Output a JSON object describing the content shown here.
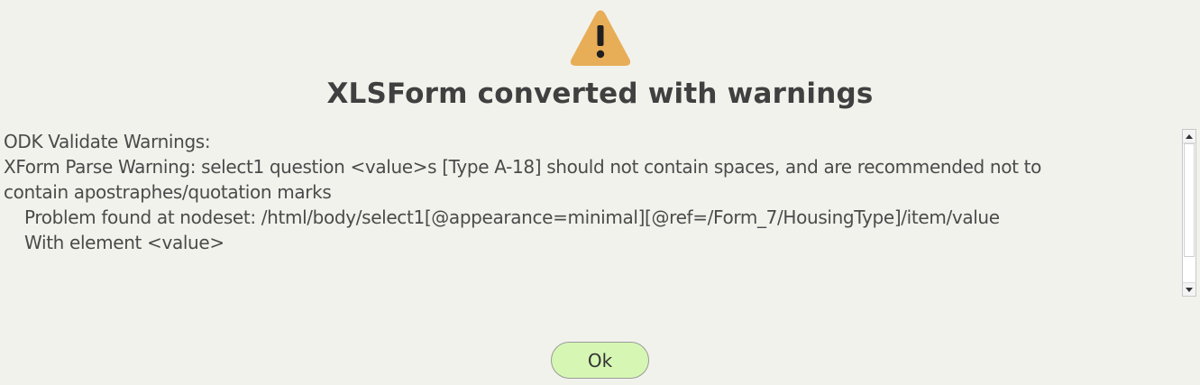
{
  "dialog": {
    "icon": "warning-triangle-icon",
    "icon_color": "#e8ad57",
    "title": "XLSForm converted with warnings",
    "messages": [
      "ODK Validate Warnings:",
      "XForm Parse Warning: select1 question <value>s [Type A-18] should not contain spaces, and are recommended not to",
      "contain apostraphes/quotation marks",
      "Problem found at nodeset: /html/body/select1[@appearance=minimal][@ref=/Form_7/HousingType]/item/value",
      "With element <value>"
    ],
    "ok_label": "Ok",
    "ok_button_color": "#d6f7b4",
    "background_color": "#f2f2ed"
  }
}
